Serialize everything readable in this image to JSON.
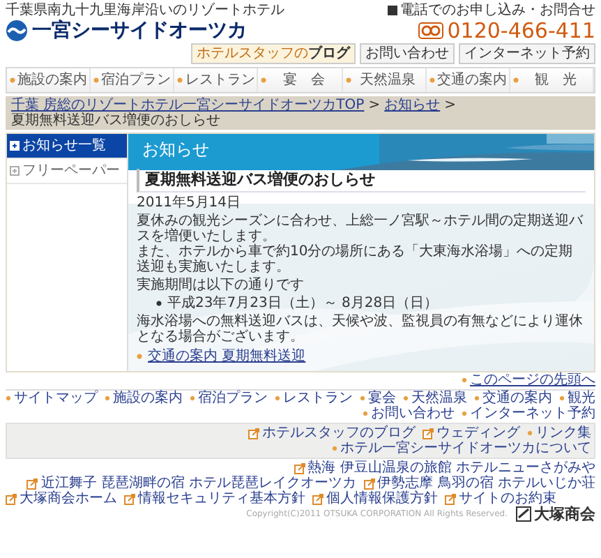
{
  "header": {
    "tagline": "千葉県南九十九里海岸沿いのリゾートホテル",
    "logo_text": "一宮シーサイドオーツカ",
    "blog_button": "ホテルスタッフの**ブログ**",
    "contact_button": "お問い合わせ",
    "reservation_button": "インターネット予約",
    "phone_label": "電話でのお申し込み・お問合せ",
    "phone_number": "0120-466-411"
  },
  "nav": [
    {
      "label": "施設の案内"
    },
    {
      "label": "宿泊プラン"
    },
    {
      "label": "レストラン"
    },
    {
      "label": "宴　会"
    },
    {
      "label": "天然温泉"
    },
    {
      "label": "交通の案内"
    },
    {
      "label": "観　光"
    }
  ],
  "breadcrumb_separator": ">",
  "breadcrumb": [
    {
      "label": "千葉 房総のリゾートホテル一宮シーサイドオーツカTOP",
      "link": true
    },
    {
      "label": "お知らせ",
      "link": true
    },
    {
      "label": "夏期無料送迎バス増便のおしらせ",
      "link": false
    }
  ],
  "sidebar": [
    {
      "label": "お知らせ一覧",
      "selected": true
    },
    {
      "label": "フリーペーパー",
      "selected": false
    }
  ],
  "main": {
    "heading": "お知らせ",
    "article_title": "夏期無料送迎バス増便のおしらせ",
    "date": "2011年5月14日",
    "lines": [
      "夏休みの観光シーズンに合わせ、上総一ノ宮駅～ホテル間の定期送迎バスを増便いたします。",
      "また、ホテルから車で約10分の場所にある「大東海水浴場」への定期送迎も実施いたします。"
    ],
    "period_label": "実施期間は以下の通りです",
    "period_items": [
      "平成23年7月23日（土）～ 8月28日（日）"
    ],
    "note": "海水浴場への無料送迎バスは、天候や波、監視員の有無などにより運休となる場合がございます。",
    "related_link": "交通の案内 夏期無料送迎"
  },
  "page_top_link": "このページの先頭へ",
  "footer_nav": [
    "サイトマップ",
    "施設の案内",
    "宿泊プラン",
    "レストラン",
    "宴会",
    "天然温泉",
    "交通の案内",
    "観光",
    "お問い合わせ",
    "インターネット予約"
  ],
  "footer_links": [
    {
      "label": "ホテルスタッフのブログ",
      "kind": "external"
    },
    {
      "label": "ウェディング",
      "kind": "external"
    },
    {
      "label": "リンク集",
      "kind": "internal"
    },
    {
      "label": "ホテル一宮シーサイドオーツカについて",
      "kind": "internal"
    }
  ],
  "partner_links": [
    "熱海 伊豆山温泉の旅館 ホテルニューさがみや",
    "近江舞子 琵琶湖畔の宿 ホテル琵琶レイクオーツカ",
    "伊勢志摩 鳥羽の宿 ホテルいじか荘"
  ],
  "corporate_links": [
    "大塚商会ホーム",
    "情報セキュリティ基本方針",
    "個人情報保護方針",
    "サイトのお約束"
  ],
  "copyright": "Copyright(C)2011 OTSUKA CORPORATION All Rights Reserved.",
  "company_logo_text": "大塚商会"
}
